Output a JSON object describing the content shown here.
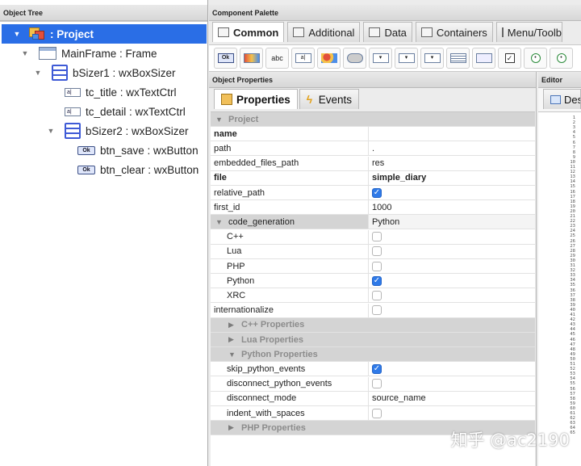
{
  "object_tree": {
    "header": "Object Tree",
    "nodes": [
      {
        "label": ": Project",
        "icon": "project-icon"
      },
      {
        "label": "MainFrame : Frame",
        "icon": "frame-icon"
      },
      {
        "label": "bSizer1 : wxBoxSizer",
        "icon": "box-sizer-icon"
      },
      {
        "label": "tc_title : wxTextCtrl",
        "icon": "text-ctrl-icon"
      },
      {
        "label": "tc_detail : wxTextCtrl",
        "icon": "text-ctrl-icon"
      },
      {
        "label": "bSizer2 : wxBoxSizer",
        "icon": "box-sizer-icon"
      },
      {
        "label": "btn_save : wxButton",
        "icon": "button-icon"
      },
      {
        "label": "btn_clear : wxButton",
        "icon": "button-icon"
      }
    ]
  },
  "palette": {
    "header": "Component Palette",
    "tabs": [
      "Common",
      "Additional",
      "Data",
      "Containers",
      "Menu/Toolbar"
    ],
    "tools": [
      "ok-button-icon",
      "bitmap-button-icon",
      "abc",
      "text-ctrl-icon",
      "bitmap-icon",
      "combo-icon",
      "choice-icon",
      "list-box-icon",
      "list-ctrl-icon",
      "grid-icon",
      "combo-box-icon",
      "checkbox-icon",
      "radio-button-icon",
      "radio-icon"
    ],
    "tool_label_abc": "abc",
    "tool_label_ok": "Ok"
  },
  "properties": {
    "header": "Object Properties",
    "tabs": [
      "Properties",
      "Events"
    ],
    "rows": [
      {
        "kind": "cat",
        "key": "Project"
      },
      {
        "kind": "bold",
        "key": "name",
        "value": ""
      },
      {
        "kind": "plain",
        "key": "path",
        "value": "."
      },
      {
        "kind": "plain",
        "key": "embedded_files_path",
        "value": "res"
      },
      {
        "kind": "bold",
        "key": "file",
        "value": "simple_diary"
      },
      {
        "kind": "check",
        "key": "relative_path",
        "checked": true
      },
      {
        "kind": "plain",
        "key": "first_id",
        "value": "1000"
      },
      {
        "kind": "expand",
        "key": "code_generation",
        "value": "Python"
      },
      {
        "kind": "subcheck",
        "key": "C++",
        "checked": false
      },
      {
        "kind": "subcheck",
        "key": "Lua",
        "checked": false
      },
      {
        "kind": "subcheck",
        "key": "PHP",
        "checked": false
      },
      {
        "kind": "subcheck",
        "key": "Python",
        "checked": true
      },
      {
        "kind": "subcheck",
        "key": "XRC",
        "checked": false
      },
      {
        "kind": "check",
        "key": "internationalize",
        "checked": false
      },
      {
        "kind": "subcat",
        "key": "C++ Properties",
        "expanded": false
      },
      {
        "kind": "subcat",
        "key": "Lua Properties",
        "expanded": false
      },
      {
        "kind": "subcat",
        "key": "Python Properties",
        "expanded": true
      },
      {
        "kind": "subcheck",
        "key": "skip_python_events",
        "checked": true
      },
      {
        "kind": "subcheck",
        "key": "disconnect_python_events",
        "checked": false
      },
      {
        "kind": "subvalue",
        "key": "disconnect_mode",
        "value": "source_name"
      },
      {
        "kind": "subcheck",
        "key": "indent_with_spaces",
        "checked": false
      },
      {
        "kind": "subcat",
        "key": "PHP Properties",
        "expanded": false
      }
    ]
  },
  "editor": {
    "header": "Editor",
    "tab": "Designer"
  },
  "watermark": "知乎 @ac2190"
}
